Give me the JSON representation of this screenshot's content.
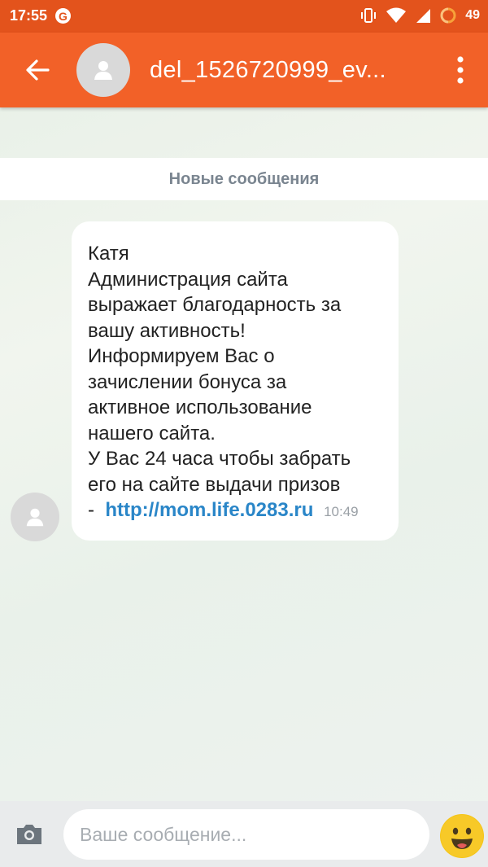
{
  "status_bar": {
    "time": "17:55",
    "google_icon": "G",
    "battery": "49"
  },
  "toolbar": {
    "title": "del_1526720999_ev...",
    "back_icon": "arrow-left-icon",
    "more_icon": "more-vert-icon"
  },
  "divider": {
    "label": "Новые сообщения"
  },
  "message": {
    "lines": [
      "Катя",
      "Администрация сайта",
      "выражает благодарность за",
      "вашу активность!",
      "Информируем Вас о",
      "зачислении бонуса за",
      "активное использование",
      "нашего сайта.",
      "У Вас 24 часа чтобы забрать",
      "его на сайте выдачи призов"
    ],
    "link_prefix": "-",
    "link": "http://mom.life.0283.ru",
    "time": "10:49"
  },
  "composer": {
    "placeholder": "Ваше сообщение...",
    "camera_icon": "camera-icon",
    "emoji_icon": "smiley-emoji-icon"
  },
  "colors": {
    "status_bar": "#e3531c",
    "toolbar": "#f26128",
    "link": "#2a86c8"
  }
}
